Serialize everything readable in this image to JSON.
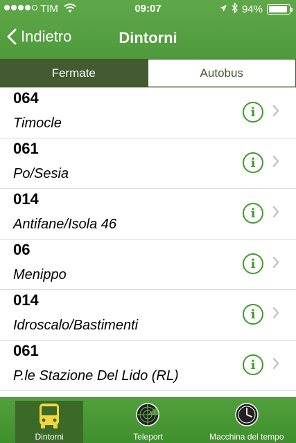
{
  "status_bar": {
    "carrier": "TIM",
    "time": "09:07",
    "battery": "94%",
    "battery_level": 0.94,
    "signal_bars": 4
  },
  "nav": {
    "back_label": "Indietro",
    "title": "Dintorni"
  },
  "segments": [
    {
      "label": "Fermate",
      "selected": true
    },
    {
      "label": "Autobus",
      "selected": false
    }
  ],
  "stops": [
    {
      "code": "064",
      "name": "Timocle"
    },
    {
      "code": "061",
      "name": "Po/Sesia"
    },
    {
      "code": "014",
      "name": "Antifane/Isola 46"
    },
    {
      "code": "06",
      "name": "Menippo"
    },
    {
      "code": "014",
      "name": "Idroscalo/Bastimenti"
    },
    {
      "code": "061",
      "name": "P.le Stazione Del Lido (RL)"
    }
  ],
  "tabs": [
    {
      "label": "Dintorni",
      "icon": "bus-icon",
      "selected": true
    },
    {
      "label": "Teleport",
      "icon": "radar-icon",
      "selected": false
    },
    {
      "label": "Macchina del tempo",
      "icon": "clock-icon",
      "selected": false
    }
  ],
  "colors": {
    "brand_green": "#4e9a3a",
    "segment_active": "#445a31",
    "info_green": "#3f9a2b"
  }
}
